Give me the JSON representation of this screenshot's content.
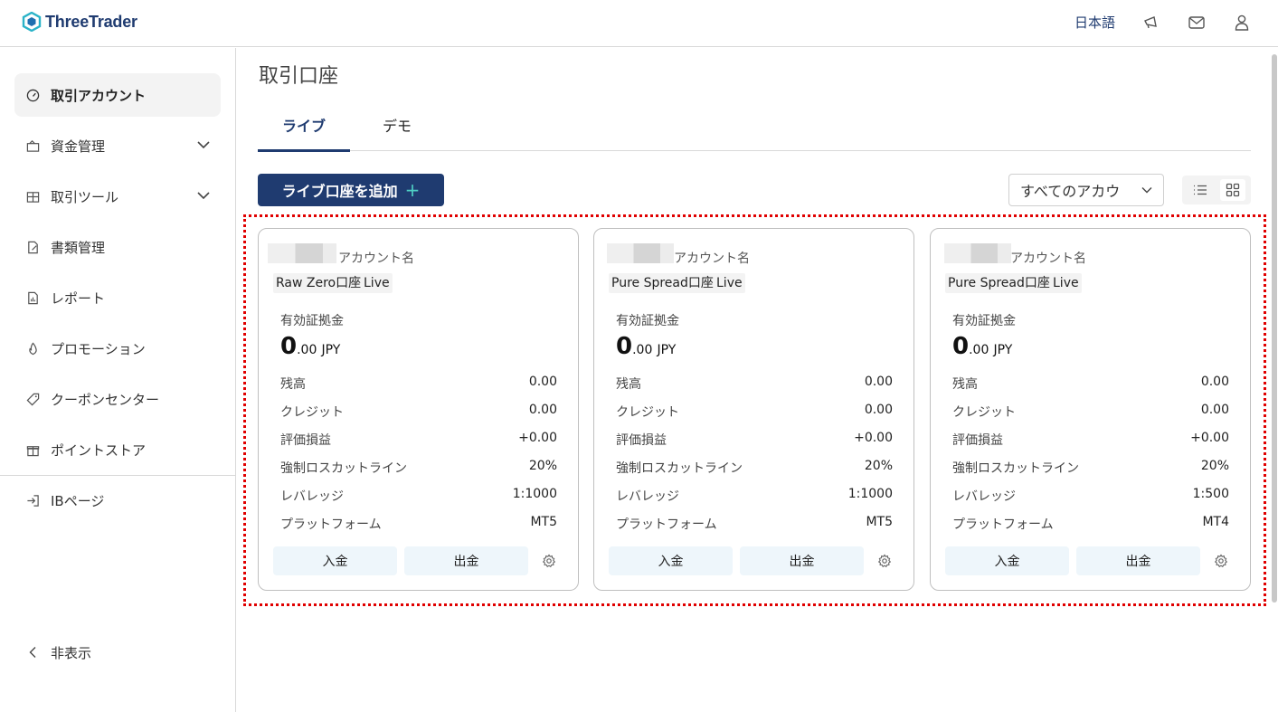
{
  "header": {
    "brand": "ThreeTrader",
    "language": "日本語",
    "icons": [
      "megaphone-icon",
      "mail-icon",
      "user-icon"
    ]
  },
  "sidebar": {
    "items": [
      {
        "label": "取引アカウント",
        "icon": "dashboard-icon",
        "active": true
      },
      {
        "label": "資金管理",
        "icon": "wallet-icon",
        "expandable": true
      },
      {
        "label": "取引ツール",
        "icon": "tools-icon",
        "expandable": true
      },
      {
        "label": "書類管理",
        "icon": "document-icon"
      },
      {
        "label": "レポート",
        "icon": "report-icon"
      },
      {
        "label": "プロモーション",
        "icon": "fire-icon"
      },
      {
        "label": "クーポンセンター",
        "icon": "coupon-icon"
      },
      {
        "label": "ポイントストア",
        "icon": "gift-icon"
      }
    ],
    "ib_label": "IBページ",
    "hide_label": "非表示"
  },
  "main": {
    "title": "取引口座",
    "tabs": [
      {
        "label": "ライブ",
        "active": true
      },
      {
        "label": "デモ"
      }
    ],
    "add_button": "ライブ口座を追加",
    "add_plus": "+",
    "filter_value": "すべてのアカウ"
  },
  "labels": {
    "account_name": "アカウント名",
    "equity": "有効証拠金",
    "currency": "JPY",
    "balance": "残高",
    "credit": "クレジット",
    "pnl": "評価損益",
    "stopout": "強制ロスカットライン",
    "leverage": "レバレッジ",
    "platform": "プラットフォーム",
    "deposit": "入金",
    "withdraw": "出金"
  },
  "cards": [
    {
      "account_type": "Raw Zero口座",
      "status": "Live",
      "equity_int": "0",
      "equity_dec": ".00",
      "balance": "0.00",
      "credit": "0.00",
      "pnl": "+0.00",
      "stopout": "20%",
      "leverage": "1:1000",
      "platform": "MT5"
    },
    {
      "account_type": "Pure Spread口座",
      "status": "Live",
      "equity_int": "0",
      "equity_dec": ".00",
      "balance": "0.00",
      "credit": "0.00",
      "pnl": "+0.00",
      "stopout": "20%",
      "leverage": "1:1000",
      "platform": "MT5"
    },
    {
      "account_type": "Pure Spread口座",
      "status": "Live",
      "equity_int": "0",
      "equity_dec": ".00",
      "balance": "0.00",
      "credit": "0.00",
      "pnl": "+0.00",
      "stopout": "20%",
      "leverage": "1:500",
      "platform": "MT4"
    }
  ],
  "colors": {
    "brand": "#1f3b70",
    "accent": "#4fd1c5",
    "highlight": "#e00000",
    "button_bg": "#eef6fb"
  }
}
